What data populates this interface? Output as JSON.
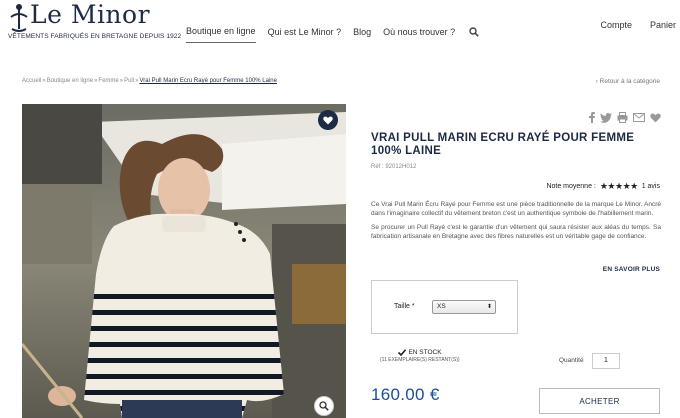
{
  "header": {
    "brand": "Le Minor",
    "tagline": "VÊTEMENTS FABRIQUÉS EN BRETAGNE DEPUIS 1922",
    "nav": [
      "Boutique en ligne",
      "Qui est Le Minor ?",
      "Blog",
      "Où nous trouver ?"
    ],
    "account": "Compte",
    "cart": "Panier"
  },
  "breadcrumb": {
    "items": [
      "Accueil",
      "Boutique en ligne",
      "Femme",
      "Pull"
    ],
    "separator": "»",
    "current": "Vrai Pull Marin Ecru Rayé pour Femme 100% Laine",
    "back": "‹ Retour à la catégorie"
  },
  "product": {
    "title": "VRAI PULL MARIN ECRU RAYÉ POUR FEMME 100% LAINE",
    "ref": "Réf : 92012H012",
    "rating_label": "Note moyenne :",
    "rating_value": 5,
    "rating_stars": "★★★★★",
    "reviews": "1 avis",
    "description": [
      "Ce Vrai Pull Marin Écru Rayé pour Femme est une pièce traditionnelle de la marque Le Minor. Ancré dans l'imaginaire collectif du vêtement breton c'est un authentique symbole de l'habillement marin.",
      "Se procurer un Pull Rayé c'est le garantie d'un vêtement qui saura résister aux aléas du temps. Sa fabrication artisanale en Bretagne avec des fibres naturelles est un véritable gage de confiance."
    ],
    "more": "EN SAVOIR PLUS",
    "size_label": "Taille *",
    "size_value": "XS",
    "stock": "EN STOCK",
    "stock_detail": "(11 EXEMPLAIRE(S) RESTANT(S))",
    "qty_label": "Quantité",
    "qty_value": "1",
    "price": "160.00 €",
    "buy": "ACHETER"
  },
  "colors": {
    "brand_navy": "#1c2a44",
    "price_blue": "#1c4d9c"
  },
  "icons": [
    "search-icon",
    "heart-icon",
    "zoom-icon",
    "facebook-icon",
    "twitter-icon",
    "print-icon",
    "mail-icon",
    "checkmark-icon"
  ]
}
